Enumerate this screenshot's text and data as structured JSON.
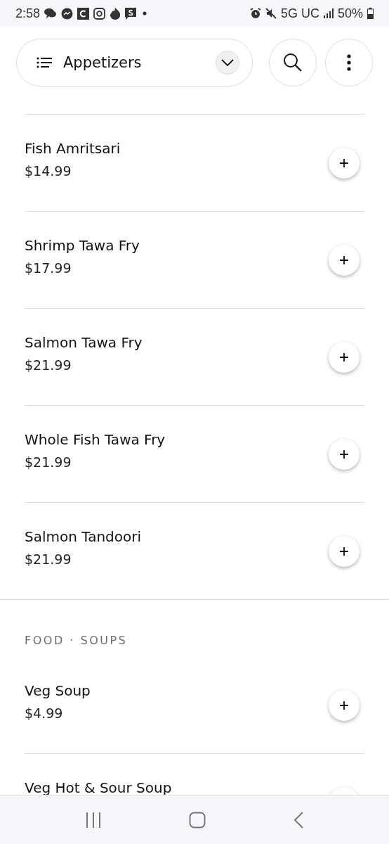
{
  "status_bar": {
    "time": "2:58",
    "network": "5G UC",
    "battery": "50%"
  },
  "header": {
    "category": "Appetizers"
  },
  "sections": [
    {
      "items": [
        {
          "name": "Fish Amritsari",
          "price": "$14.99"
        },
        {
          "name": "Shrimp Tawa Fry",
          "price": "$17.99"
        },
        {
          "name": "Salmon Tawa Fry",
          "price": "$21.99"
        },
        {
          "name": "Whole Fish Tawa Fry",
          "price": "$21.99"
        },
        {
          "name": "Salmon Tandoori",
          "price": "$21.99"
        }
      ]
    },
    {
      "heading": "FOOD · SOUPS",
      "items": [
        {
          "name": "Veg Soup",
          "price": "$4.99"
        },
        {
          "name": "Veg Hot & Sour Soup"
        }
      ]
    }
  ]
}
